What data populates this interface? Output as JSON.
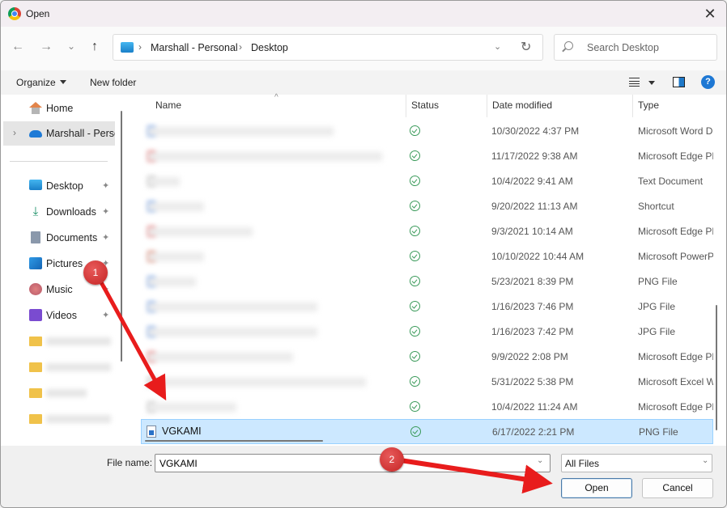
{
  "window": {
    "title": "Open",
    "close_label": "✕"
  },
  "nav": {
    "back": "←",
    "forward": "→",
    "recent": "⌄",
    "up": "↑",
    "breadcrumbs": [
      "Marshall - Personal",
      "Desktop"
    ],
    "crumb_separator": "›",
    "dropdown": "⌄",
    "refresh": "↻",
    "search_placeholder": "Search Desktop"
  },
  "toolbar": {
    "organize_label": "Organize",
    "new_folder_label": "New folder",
    "help_label": "?"
  },
  "sidebar": {
    "items": [
      {
        "label": "Home",
        "icon": "home-icon"
      },
      {
        "label": "Marshall - Personal",
        "icon": "onedrive-cloud-icon",
        "expand": "›",
        "selected": true
      },
      {
        "label": "Desktop",
        "icon": "desktop-icon",
        "pinned": true
      },
      {
        "label": "Downloads",
        "icon": "download-icon",
        "pinned": true
      },
      {
        "label": "Documents",
        "icon": "documents-icon",
        "pinned": true
      },
      {
        "label": "Pictures",
        "icon": "pictures-icon",
        "pinned": true
      },
      {
        "label": "Music",
        "icon": "music-icon",
        "pinned": true
      },
      {
        "label": "Videos",
        "icon": "videos-icon",
        "pinned": true
      }
    ],
    "pin_glyph": "📌",
    "download_glyph": "⤓",
    "blurred_folders": 4
  },
  "filelist": {
    "columns": {
      "name": "Name",
      "status": "Status",
      "date": "Date modified",
      "type": "Type"
    },
    "sort_glyph": "^",
    "rows": [
      {
        "name": "",
        "blurred": true,
        "date": "10/30/2022 4:37 PM",
        "type": "Microsoft Word D",
        "icon_color": "#3b7be0"
      },
      {
        "name": "",
        "blurred": true,
        "date": "11/17/2022 9:38 AM",
        "type": "Microsoft Edge PD",
        "icon_color": "#e04040"
      },
      {
        "name": "",
        "blurred": true,
        "date": "10/4/2022 9:41 AM",
        "type": "Text Document",
        "icon_color": "#b0b0b0"
      },
      {
        "name": "",
        "blurred": true,
        "date": "9/20/2022 11:13 AM",
        "type": "Shortcut",
        "icon_color": "#3b7be0"
      },
      {
        "name": "",
        "blurred": true,
        "date": "9/3/2021 10:14 AM",
        "type": "Microsoft Edge PD",
        "icon_color": "#e04040"
      },
      {
        "name": "",
        "blurred": true,
        "date": "10/10/2022 10:44 AM",
        "type": "Microsoft PowerP",
        "icon_color": "#d04a2a"
      },
      {
        "name": "",
        "blurred": true,
        "date": "5/23/2021 8:39 PM",
        "type": "PNG File",
        "icon_color": "#3b7be0"
      },
      {
        "name": "",
        "blurred": true,
        "date": "1/16/2023 7:46 PM",
        "type": "JPG File",
        "icon_color": "#3b7be0"
      },
      {
        "name": "",
        "blurred": true,
        "date": "1/16/2023 7:42 PM",
        "type": "JPG File",
        "icon_color": "#3b7be0"
      },
      {
        "name": "",
        "blurred": true,
        "date": "9/9/2022 2:08 PM",
        "type": "Microsoft Edge PD",
        "icon_color": "#e04040"
      },
      {
        "name": "",
        "blurred": true,
        "date": "5/31/2022 5:38 PM",
        "type": "Microsoft Excel W",
        "icon_color": "#b0b0b0"
      },
      {
        "name": "",
        "blurred": true,
        "date": "10/4/2022 11:24 AM",
        "type": "Microsoft Edge PD",
        "icon_color": "#b0b0b0"
      },
      {
        "name": "VGKAMI",
        "blurred": false,
        "selected": true,
        "date": "6/17/2022 2:21 PM",
        "type": "PNG File"
      }
    ]
  },
  "bottom": {
    "filename_label": "File name:",
    "filename_value": "VGKAMI",
    "filetype_value": "All Files",
    "dropdown_glyph": "⌄",
    "open_label": "Open",
    "cancel_label": "Cancel"
  },
  "annotations": {
    "step1": "1",
    "step2": "2",
    "color": "#e81c1c"
  }
}
